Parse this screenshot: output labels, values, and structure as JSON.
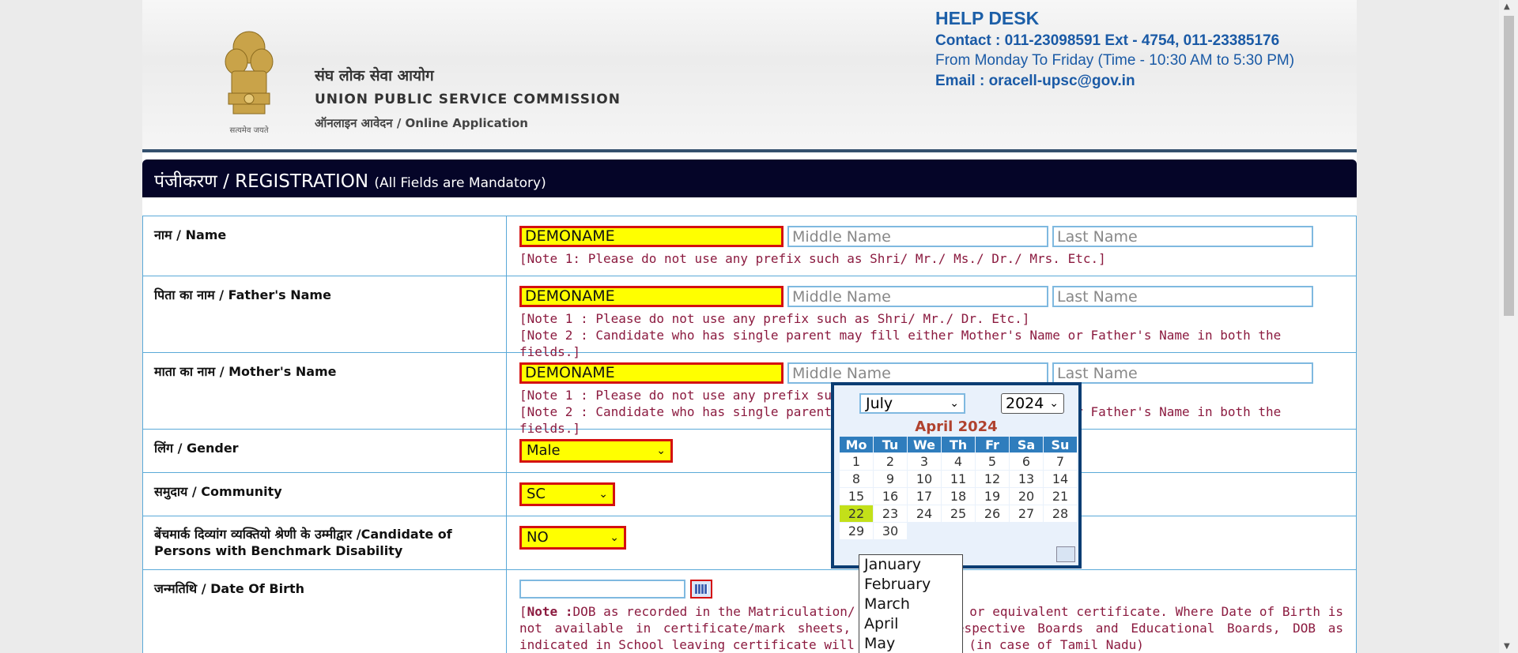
{
  "header": {
    "org_hindi": "संघ लोक सेवा आयोग",
    "org_english": "UNION  PUBLIC SERVICE COMMISSION",
    "online_app": "ऑनलाइन आवेदन / Online Application",
    "emblem_motto": "सत्यमेव जयते"
  },
  "helpdesk": {
    "title": "HELP DESK",
    "contact": "Contact : 011-23098591 Ext - 4754, 011-23385176",
    "hours": "From Monday To Friday (Time - 10:30 AM to 5:30 PM)",
    "email": "Email : oracell-upsc@gov.in"
  },
  "banner": {
    "title": "पंजीकरण / REGISTRATION",
    "subtitle": "(All Fields are Mandatory)"
  },
  "rows": {
    "name": {
      "label": "नाम / Name",
      "first": "DEMONAME",
      "middle_ph": "Middle Name",
      "last_ph": "Last Name",
      "note1": "[Note 1: Please do not use any prefix such as Shri/ Mr./ Ms./ Dr./ Mrs. Etc.]"
    },
    "father": {
      "label": "पिता का नाम / Father's Name",
      "first": "DEMONAME",
      "middle_ph": "Middle Name",
      "last_ph": "Last Name",
      "note1": "[Note 1 : Please do not use any prefix such as Shri/ Mr./ Dr. Etc.]",
      "note2": "[Note 2 : Candidate who has single parent may fill either Mother's Name or Father's Name in both the fields.]"
    },
    "mother": {
      "label": "माता का नाम / Mother's Name",
      "first": "DEMONAME",
      "middle_ph": "Middle Name",
      "last_ph": "Last Name",
      "note1": "[Note 1 : Please do not use any prefix such as Shri/ Mr./ Dr. Etc.]",
      "note2": "[Note 2 : Candidate who has single parent may fill either Mother's Name or Father's Name in both the fields.]"
    },
    "gender": {
      "label": "लिंग / Gender",
      "value": "Male"
    },
    "community": {
      "label": "समुदाय / Community",
      "value": "SC"
    },
    "disability": {
      "label": "बेंचमार्क दिव्यांग व्यक्तियो श्रेणी के उम्मीद्वार /Candidate of Persons with Benchmark Disability",
      "value": "NO"
    },
    "dob": {
      "label": "जन्मतिथि / Date Of Birth",
      "note_bold": "Note :",
      "note": "DOB as recorded in the Matriculation/ 10th Standard or equivalent certificate. Where Date of Birth is not available in certificate/mark sheets, issued by respective Boards and Educational Boards, DOB as indicated in School leaving certificate will be considered (in case of Tamil Nadu)"
    }
  },
  "calendar": {
    "month_select": "July",
    "year_select": "2024",
    "title": "April 2024",
    "weekdays": [
      "Mo",
      "Tu",
      "We",
      "Th",
      "Fr",
      "Sa",
      "Su"
    ],
    "weeks": [
      [
        "1",
        "2",
        "3",
        "4",
        "5",
        "6",
        "7"
      ],
      [
        "8",
        "9",
        "10",
        "11",
        "12",
        "13",
        "14"
      ],
      [
        "15",
        "16",
        "17",
        "18",
        "19",
        "20",
        "21"
      ],
      [
        "22",
        "23",
        "24",
        "25",
        "26",
        "27",
        "28"
      ],
      [
        "29",
        "30",
        "",
        "",
        "",
        "",
        ""
      ]
    ],
    "today": "22"
  },
  "month_dropdown": [
    "January",
    "February",
    "March",
    "April",
    "May"
  ],
  "colors": {
    "accent_red": "#d41010",
    "highlight": "#ffff00",
    "note_text": "#8b1a3f",
    "banner": "#050528"
  }
}
